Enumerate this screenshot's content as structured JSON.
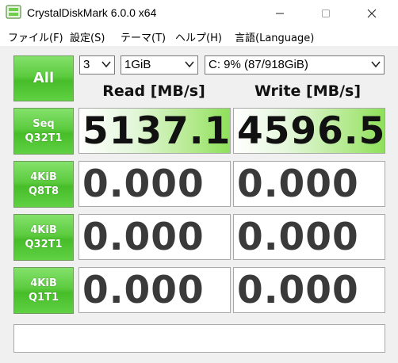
{
  "window": {
    "title": "CrystalDiskMark 6.0.0 x64"
  },
  "menu": [
    "ファイル(F)",
    "設定(S)",
    "テーマ(T)",
    "ヘルプ(H)",
    "言語(Language)"
  ],
  "controls": {
    "all_label": "All",
    "count": "3",
    "size": "1GiB",
    "drive": "C: 9% (87/918GiB)"
  },
  "headers": {
    "read": "Read [MB/s]",
    "write": "Write [MB/s]"
  },
  "rows": [
    {
      "line1": "Seq",
      "line2": "Q32T1",
      "read": "5137.1",
      "write": "4596.5",
      "read_fill": 1.0,
      "write_fill": 1.0
    },
    {
      "line1": "4KiB",
      "line2": "Q8T8",
      "read": "0.000",
      "write": "0.000",
      "read_fill": 0,
      "write_fill": 0
    },
    {
      "line1": "4KiB",
      "line2": "Q32T1",
      "read": "0.000",
      "write": "0.000",
      "read_fill": 0,
      "write_fill": 0
    },
    {
      "line1": "4KiB",
      "line2": "Q1T1",
      "read": "0.000",
      "write": "0.000",
      "read_fill": 0,
      "write_fill": 0
    }
  ],
  "status_text": "",
  "colors": {
    "accent_green": "#47bd29",
    "bar_green": "#8ee05a"
  }
}
